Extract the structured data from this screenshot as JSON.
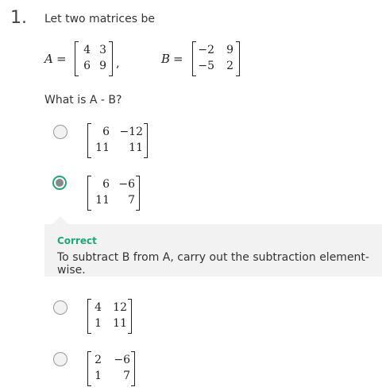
{
  "question": {
    "number": "1.",
    "prompt": "Let two matrices be",
    "matrix_a_label": "A",
    "matrix_b_label": "B",
    "equals": "=",
    "comma": ",",
    "matrix_a": [
      [
        "4",
        "3"
      ],
      [
        "6",
        "9"
      ]
    ],
    "matrix_b": [
      [
        "−2",
        "9"
      ],
      [
        "−5",
        "2"
      ]
    ],
    "ask": "What is A - B?"
  },
  "options": [
    {
      "selected": false,
      "matrix": [
        [
          "6",
          "−12"
        ],
        [
          "11",
          "11"
        ]
      ]
    },
    {
      "selected": true,
      "matrix": [
        [
          "6",
          "−6"
        ],
        [
          "11",
          "7"
        ]
      ]
    },
    {
      "selected": false,
      "matrix": [
        [
          "4",
          "12"
        ],
        [
          "1",
          "11"
        ]
      ]
    },
    {
      "selected": false,
      "matrix": [
        [
          "2",
          "−6"
        ],
        [
          "1",
          "7"
        ]
      ]
    }
  ],
  "feedback": {
    "status": "Correct",
    "message": "To subtract B from A, carry out the subtraction element-wise.",
    "status_color": "#1aa97a"
  }
}
